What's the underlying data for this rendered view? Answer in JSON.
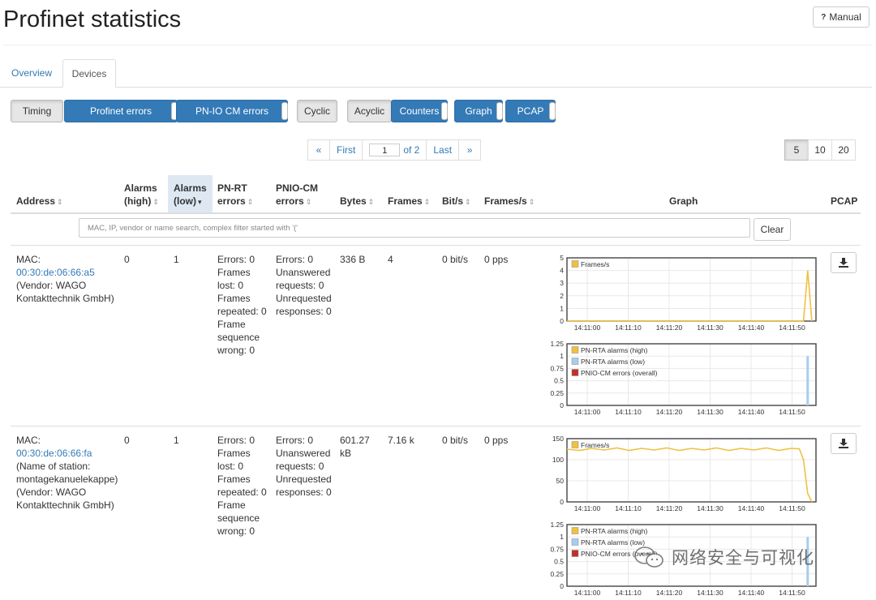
{
  "page": {
    "title": "Profinet statistics",
    "manual_label": "Manual"
  },
  "tabs": [
    {
      "label": "Overview"
    },
    {
      "label": "Devices"
    }
  ],
  "filters": [
    {
      "label": "Timing",
      "active": false
    },
    {
      "label": "Profinet errors",
      "active": true
    },
    {
      "label": "PN-IO CM errors",
      "active": true
    },
    {
      "label": "Cyclic",
      "active": false
    },
    {
      "label": "Acyclic",
      "active": false
    },
    {
      "label": "Counters",
      "active": true
    },
    {
      "label": "Graph",
      "active": true
    },
    {
      "label": "PCAP",
      "active": true
    }
  ],
  "pagination": {
    "prev": "«",
    "first": "First",
    "current": "1",
    "of": "of 2",
    "last": "Last",
    "next": "»"
  },
  "page_sizes": {
    "options": [
      "5",
      "10",
      "20"
    ],
    "selected": "5"
  },
  "columns": {
    "address": "Address",
    "alarms_high": [
      "Alarms",
      "(high)"
    ],
    "alarms_low": [
      "Alarms",
      "(low)"
    ],
    "pnrt": [
      "PN-RT",
      "errors"
    ],
    "pniocm": [
      "PNIO-CM",
      "errors"
    ],
    "bytes": "Bytes",
    "frames": "Frames",
    "bits": "Bit/s",
    "fps": "Frames/s",
    "graph": "Graph",
    "pcap": "PCAP"
  },
  "search": {
    "placeholder": "MAC, IP, vendor or name search, complex filter started with '('",
    "clear_label": "Clear"
  },
  "rows": [
    {
      "mac_prefix": "MAC:",
      "mac": "00:30:de:06:66:a5",
      "name_lines": [
        "(Vendor: WAGO",
        "Kontakttechnik GmbH)"
      ],
      "alarms_high": "0",
      "alarms_low": "1",
      "pnrt_lines": [
        "Errors: 0",
        "Frames",
        "lost: 0",
        "Frames",
        "repeated: 0",
        "Frame",
        "sequence",
        "wrong: 0"
      ],
      "pniocm_lines": [
        "Errors: 0",
        "Unanswered",
        "requests: 0",
        "Unrequested",
        "responses: 0"
      ],
      "bytes_lines": [
        "336 B"
      ],
      "frames": "4",
      "bits": "0 bit/s",
      "fps": "0 pps"
    },
    {
      "mac_prefix": "MAC:",
      "mac": "00:30:de:06:66:fa",
      "name_lines": [
        "(Name of station:",
        "montagekanuelekappe)",
        "(Vendor: WAGO",
        "Kontakttechnik GmbH)"
      ],
      "alarms_high": "0",
      "alarms_low": "1",
      "pnrt_lines": [
        "Errors: 0",
        "Frames",
        "lost: 0",
        "Frames",
        "repeated: 0",
        "Frame",
        "sequence",
        "wrong: 0"
      ],
      "pniocm_lines": [
        "Errors: 0",
        "Unanswered",
        "requests: 0",
        "Unrequested",
        "responses: 0"
      ],
      "bytes_lines": [
        "601.27",
        "kB"
      ],
      "frames": "7.16 k",
      "bits": "0 bit/s",
      "fps": "0 pps"
    }
  ],
  "chart_data": [
    {
      "type": "line",
      "legend": [
        "Frames/s"
      ],
      "x": [
        "14:11:00",
        "14:11:10",
        "14:11:20",
        "14:11:30",
        "14:11:40",
        "14:11:50"
      ],
      "y_ticks": [
        "0",
        "1",
        "2",
        "3",
        "4",
        "5"
      ],
      "ylim": [
        0,
        5
      ],
      "series": [
        {
          "name": "Frames/s",
          "color": "#f0c040",
          "points": [
            [
              0,
              0
            ],
            [
              57,
              0
            ],
            [
              58,
              4
            ],
            [
              59,
              0
            ]
          ]
        }
      ]
    },
    {
      "type": "bar",
      "legend": [
        "PN-RTA alarms (high)",
        "PN-RTA alarms (low)",
        "PNIO-CM errors (overall)"
      ],
      "legend_colors": [
        "#f0c040",
        "#a8cdec",
        "#c0302a"
      ],
      "x": [
        "14:11:00",
        "14:11:10",
        "14:11:20",
        "14:11:30",
        "14:11:40",
        "14:11:50"
      ],
      "y_ticks": [
        "0",
        "0.25",
        "0.5",
        "0.75",
        "1",
        "1.25"
      ],
      "ylim": [
        0,
        1.25
      ],
      "series": [
        {
          "name": "PN-RTA alarms (low)",
          "color": "#a8cdec",
          "points": [
            [
              58,
              1
            ]
          ]
        }
      ]
    },
    {
      "type": "line",
      "legend": [
        "Frames/s"
      ],
      "x": [
        "14:11:00",
        "14:11:10",
        "14:11:20",
        "14:11:30",
        "14:11:40",
        "14:11:50"
      ],
      "y_ticks": [
        "0",
        "50",
        "100",
        "150"
      ],
      "ylim": [
        0,
        150
      ],
      "series": [
        {
          "name": "Frames/s",
          "color": "#f0c040",
          "points": [
            [
              0,
              125
            ],
            [
              3,
              122
            ],
            [
              6,
              127
            ],
            [
              9,
              123
            ],
            [
              12,
              128
            ],
            [
              15,
              122
            ],
            [
              18,
              127
            ],
            [
              21,
              123
            ],
            [
              24,
              128
            ],
            [
              27,
              122
            ],
            [
              30,
              127
            ],
            [
              33,
              123
            ],
            [
              36,
              128
            ],
            [
              39,
              122
            ],
            [
              42,
              127
            ],
            [
              45,
              123
            ],
            [
              48,
              128
            ],
            [
              51,
              122
            ],
            [
              54,
              127
            ],
            [
              56,
              126
            ],
            [
              57,
              100
            ],
            [
              58,
              20
            ],
            [
              59,
              0
            ]
          ]
        }
      ]
    },
    {
      "type": "bar",
      "legend": [
        "PN-RTA alarms (high)",
        "PN-RTA alarms (low)",
        "PNIO-CM errors (overall)"
      ],
      "legend_colors": [
        "#f0c040",
        "#a8cdec",
        "#c0302a"
      ],
      "x": [
        "14:11:00",
        "14:11:10",
        "14:11:20",
        "14:11:30",
        "14:11:40",
        "14:11:50"
      ],
      "y_ticks": [
        "0",
        "0.25",
        "0.5",
        "0.75",
        "1",
        "1.25"
      ],
      "ylim": [
        0,
        1.25
      ],
      "series": [
        {
          "name": "PN-RTA alarms (low)",
          "color": "#a8cdec",
          "points": [
            [
              58,
              1
            ]
          ]
        }
      ]
    }
  ],
  "watermark": {
    "text": "网络安全与可视化"
  }
}
